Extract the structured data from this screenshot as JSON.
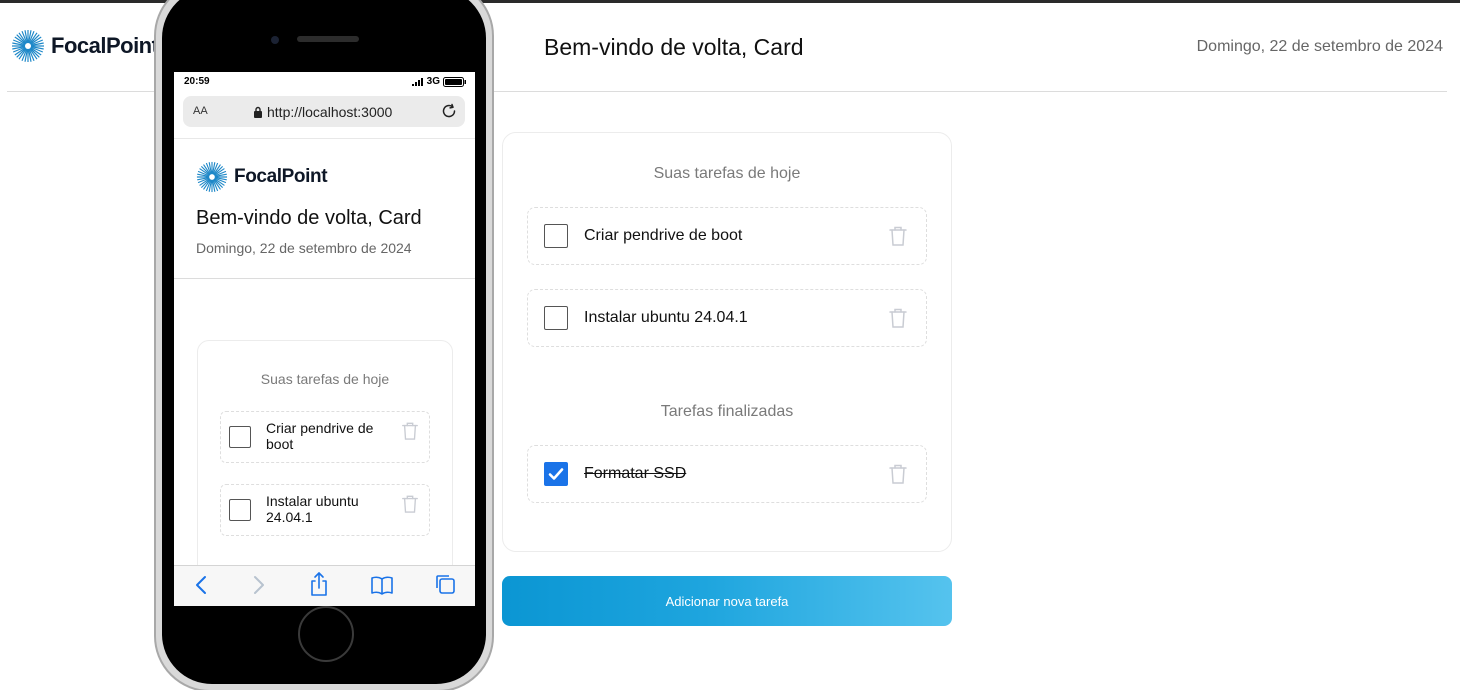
{
  "header": {
    "brand": "FocalPoint",
    "welcome": "Bem-vindo de volta, Card",
    "date": "Domingo, 22 de setembro de 2024"
  },
  "today": {
    "title": "Suas tarefas de hoje",
    "tasks": [
      {
        "label": "Criar pendrive de boot",
        "done": false
      },
      {
        "label": "Instalar ubuntu 24.04.1",
        "done": false
      }
    ]
  },
  "finished": {
    "title": "Tarefas finalizadas",
    "tasks": [
      {
        "label": "Formatar SSD",
        "done": true
      }
    ]
  },
  "add_button": "Adicionar nova tarefa",
  "phone": {
    "time": "20:59",
    "network": "3G",
    "text_size": "AA",
    "url": "http://localhost:3000",
    "brand": "FocalPoint",
    "welcome": "Bem-vindo de volta, Card",
    "date": "Domingo, 22 de setembro de 2024",
    "card_title": "Suas tarefas de hoje",
    "tasks": [
      {
        "label": "Criar pendrive de boot"
      },
      {
        "label": "Instalar ubuntu 24.04.1"
      }
    ],
    "toolbar_icons": [
      "back-icon",
      "forward-icon",
      "share-icon",
      "bookmarks-icon",
      "tabs-icon"
    ]
  },
  "colors": {
    "accent_start": "#0b96d3",
    "accent_end": "#55c3ee",
    "checkbox_checked": "#1a73e8",
    "logo": "#1e88c8"
  }
}
